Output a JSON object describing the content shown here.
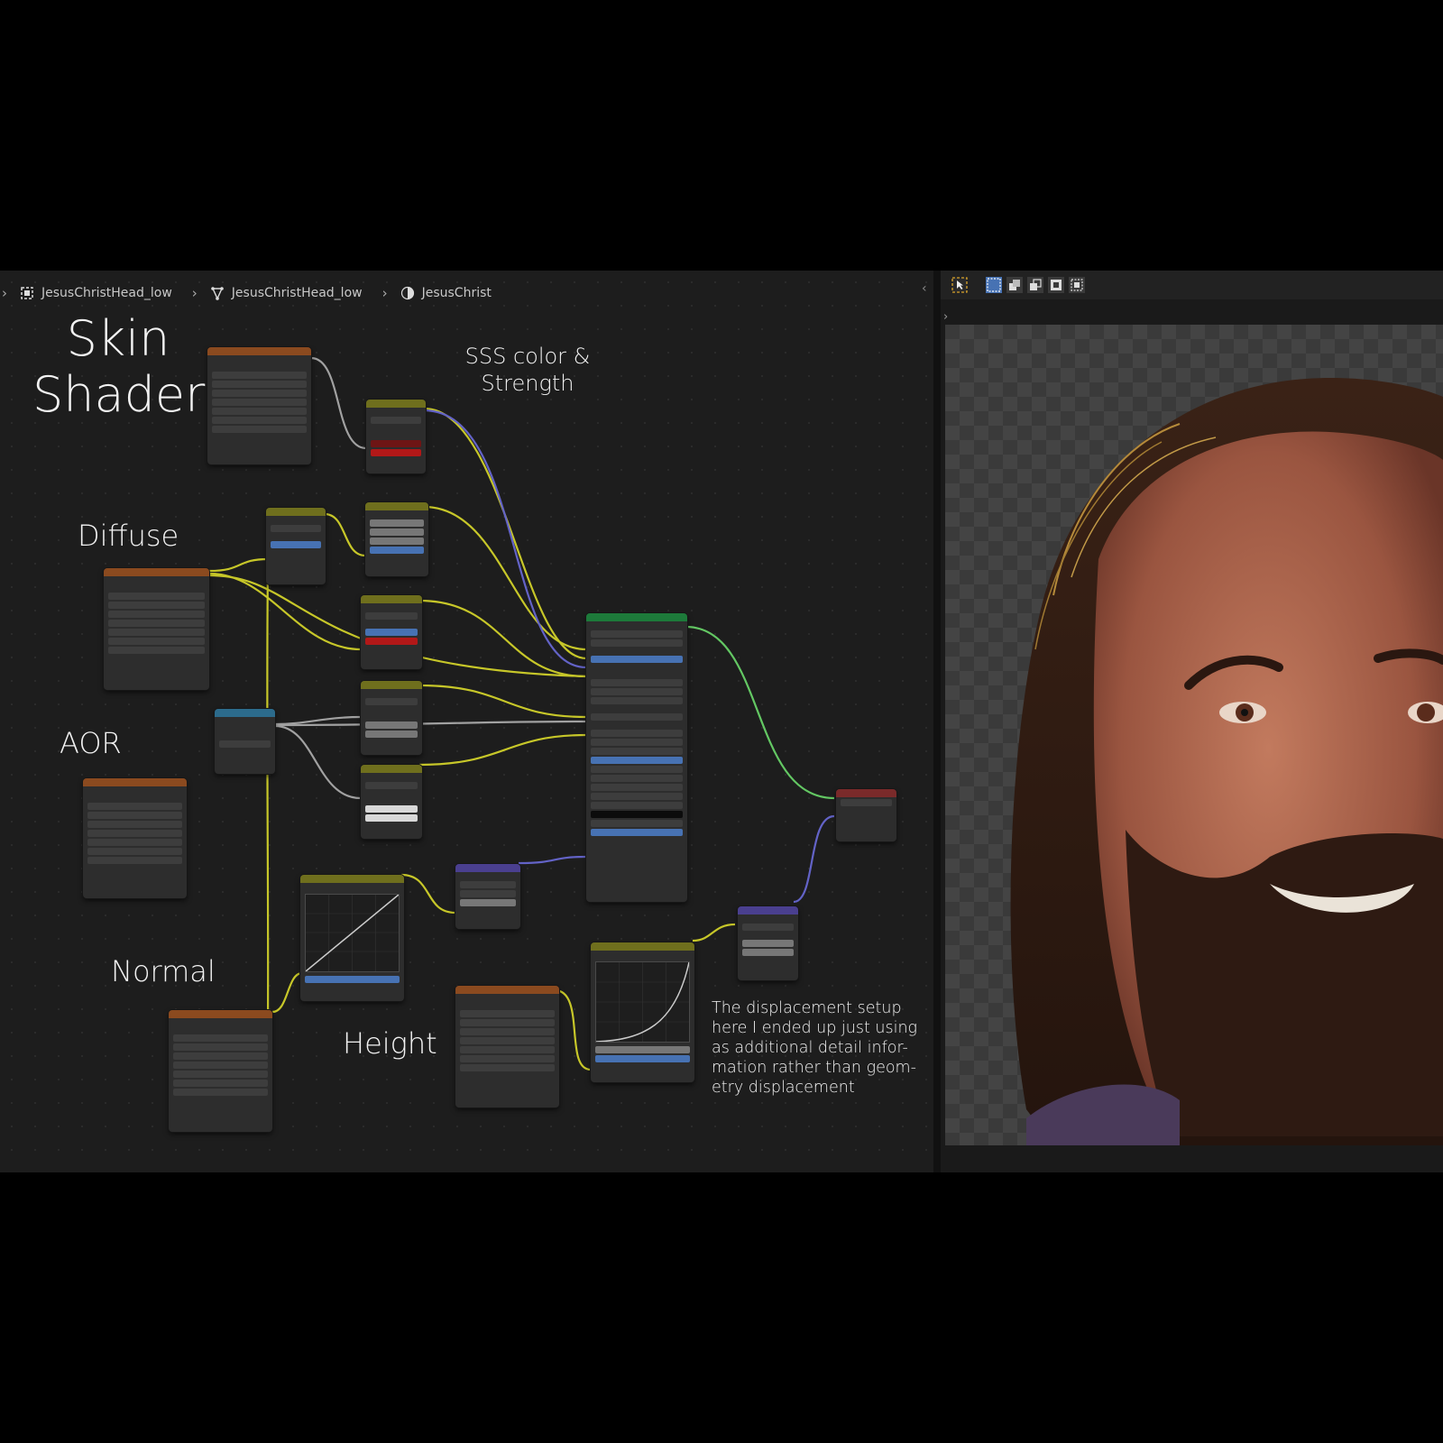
{
  "breadcrumb": [
    {
      "label": "JesusChristHead_low",
      "icon": "object-icon"
    },
    {
      "label": "JesusChristHead_low",
      "icon": "mesh-icon"
    },
    {
      "label": "JesusChrist",
      "icon": "material-icon"
    }
  ],
  "annotations": {
    "skin_line1": "Skin",
    "skin_line2": "Shader",
    "sss_line1": "SSS color &",
    "sss_line2": "Strength",
    "diffuse": "Diffuse",
    "aor": "AOR",
    "normal": "Normal",
    "height": "Height",
    "note": [
      "The displacement setup",
      "here I ended up just using",
      "as additional detail infor-",
      "mation rather than geom-",
      "etry displacement"
    ]
  },
  "viewport": {
    "render_subject": "rendered head with long brown hair and beard",
    "toolbar_icons": [
      "select-tool-icon",
      "select-box-icon",
      "select-extend-icon",
      "select-subtract-icon",
      "select-invert-icon",
      "select-intersect-icon"
    ]
  },
  "colors": {
    "editor_bg": "#1d1d1d",
    "texture_header": "#8b4a1f",
    "color_header": "#6f6f1d",
    "shader_header": "#1d7a3a",
    "vector_header": "#4a3f8f",
    "converter_header": "#2c6b8c",
    "output_header": "#7a2a2a",
    "wire_yellow": "#c7c729",
    "wire_gray": "#a1a1a1",
    "wire_purple": "#6363c7",
    "wire_green": "#63c763"
  }
}
